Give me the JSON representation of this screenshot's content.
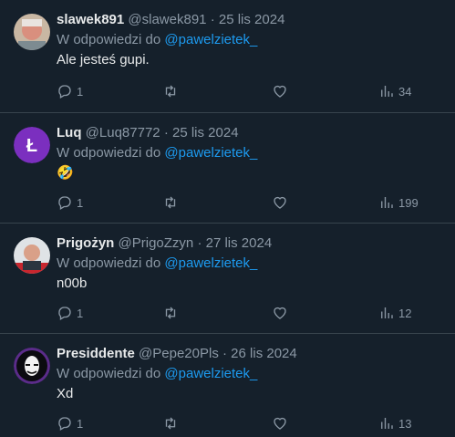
{
  "tweets": [
    {
      "name": "slawek891",
      "handle": "@slawek891",
      "sep": "·",
      "date": "25 lis 2024",
      "reply_prefix": "W odpowiedzi do",
      "reply_to": "@pawelzietek_",
      "text": "Ale jesteś gupi.",
      "replies": "1",
      "retweets": "",
      "likes": "",
      "views": "34"
    },
    {
      "name": "Luq",
      "handle": "@Luq87772",
      "sep": "·",
      "date": "25 lis 2024",
      "reply_prefix": "W odpowiedzi do",
      "reply_to": "@pawelzietek_",
      "text": "🤣",
      "replies": "1",
      "retweets": "",
      "likes": "",
      "views": "199",
      "avatar_letter": "Ł",
      "avatar_color": "#7b2fbf"
    },
    {
      "name": "Prigożyn",
      "handle": "@PrigoZzyn",
      "sep": "·",
      "date": "27 lis 2024",
      "reply_prefix": "W odpowiedzi do",
      "reply_to": "@pawelzietek_",
      "text": "n00b",
      "replies": "1",
      "retweets": "",
      "likes": "",
      "views": "12"
    },
    {
      "name": "Presiddente",
      "handle": "@Pepe20Pls",
      "sep": "·",
      "date": "26 lis 2024",
      "reply_prefix": "W odpowiedzi do",
      "reply_to": "@pawelzietek_",
      "text": "Xd",
      "replies": "1",
      "retweets": "",
      "likes": "",
      "views": "13"
    }
  ],
  "icons": {
    "reply": "reply-icon",
    "retweet": "retweet-icon",
    "like": "heart-icon",
    "views": "views-icon"
  },
  "colors": {
    "background": "#15202b",
    "text": "#e7e9ea",
    "muted": "#8b98a5",
    "accent": "#1d9bf0",
    "divider": "#38444d"
  }
}
